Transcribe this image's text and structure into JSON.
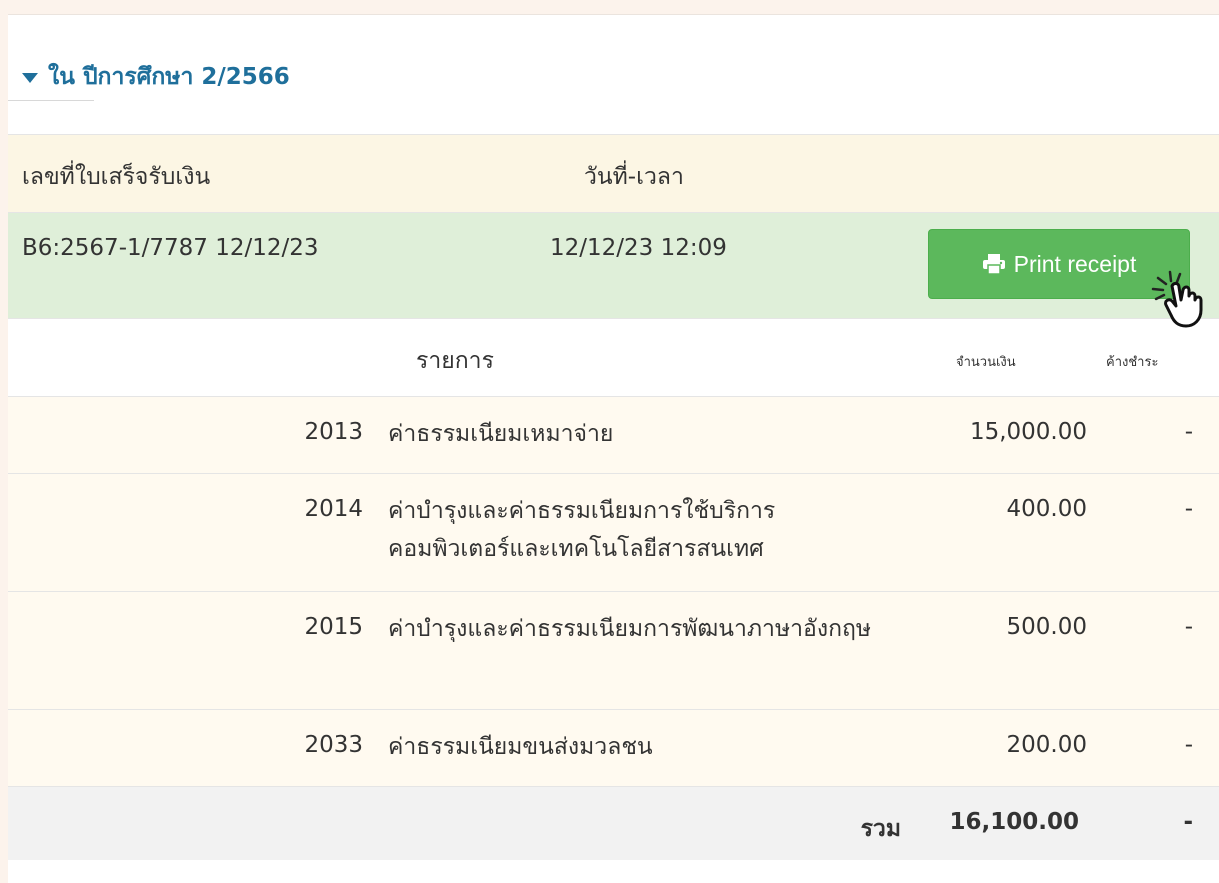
{
  "section": {
    "title": "ใน ปีการศึกษา 2/2566"
  },
  "receipt_table": {
    "headers": {
      "receipt_no": "เลขที่ใบเสร็จรับเงิน",
      "datetime": "วันที่-เวลา"
    },
    "receipt": {
      "number": "B6:2567-1/7787 12/12/23",
      "datetime": "12/12/23 12:09",
      "print_button_label": "Print receipt"
    }
  },
  "items_table": {
    "headers": {
      "item": "รายการ",
      "amount": "จำนวนเงิน",
      "outstanding": "ค้างชำระ"
    },
    "rows": [
      {
        "code": "2013",
        "description": "ค่าธรรมเนียมเหมาจ่าย",
        "amount": "15,000.00",
        "outstanding": "-"
      },
      {
        "code": "2014",
        "description": "ค่าบำรุงและค่าธรรมเนียมการใช้บริการคอมพิวเตอร์และเทคโนโลยีสารสนเทศ",
        "amount": "400.00",
        "outstanding": "-"
      },
      {
        "code": "2015",
        "description": "ค่าบำรุงและค่าธรรมเนียมการพัฒนาภาษาอังกฤษ",
        "amount": "500.00",
        "outstanding": "-"
      },
      {
        "code": "2033",
        "description": "ค่าธรรมเนียมขนส่งมวลชน",
        "amount": "200.00",
        "outstanding": "-"
      }
    ],
    "total": {
      "label": "รวม",
      "amount": "16,100.00",
      "outstanding": "-"
    }
  },
  "colors": {
    "accent_blue": "#1f6f9b",
    "button_green": "#5cb85c",
    "receipt_row_bg": "#dfefd9",
    "header_row_bg": "#fcf6e4"
  },
  "icons": {
    "caret": "caret-down-icon",
    "printer": "printer-icon",
    "pointer": "hand-pointer-icon"
  }
}
